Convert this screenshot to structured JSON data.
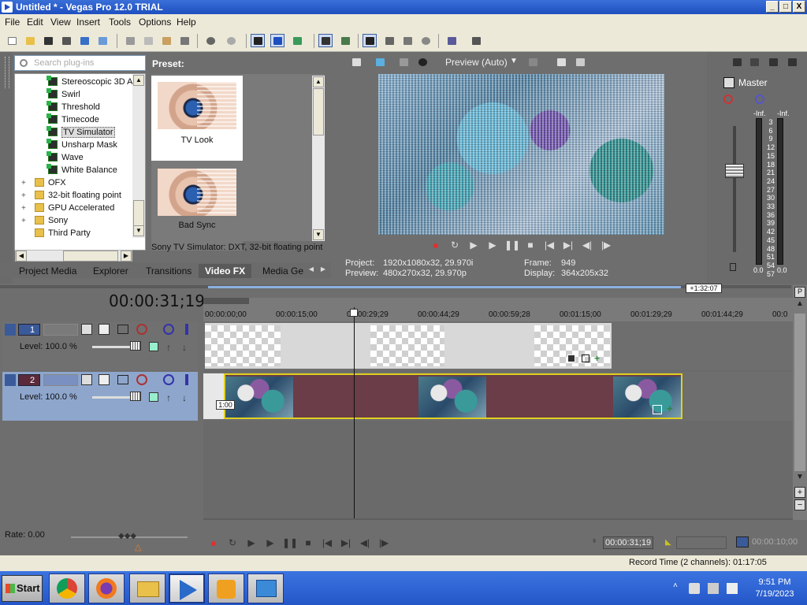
{
  "window": {
    "title": "Untitled * - Vegas Pro 12.0 TRIAL",
    "min": "_",
    "max": "□",
    "close": "X"
  },
  "menu": [
    "File",
    "Edit",
    "View",
    "Insert",
    "Tools",
    "Options",
    "Help"
  ],
  "plugins": {
    "search_placeholder": "Search plug-ins",
    "items": [
      {
        "label": "Stereoscopic 3D A",
        "type": "fx"
      },
      {
        "label": "Swirl",
        "type": "fx"
      },
      {
        "label": "Threshold",
        "type": "fx"
      },
      {
        "label": "Timecode",
        "type": "fx"
      },
      {
        "label": "TV Simulator",
        "type": "fx",
        "selected": true
      },
      {
        "label": "Unsharp Mask",
        "type": "fx"
      },
      {
        "label": "Wave",
        "type": "fx"
      },
      {
        "label": "White Balance",
        "type": "fx"
      },
      {
        "label": "OFX",
        "type": "folder"
      },
      {
        "label": "32-bit floating point",
        "type": "folder"
      },
      {
        "label": "GPU Accelerated",
        "type": "folder"
      },
      {
        "label": "Sony",
        "type": "folder"
      },
      {
        "label": "Third Party",
        "type": "folder"
      }
    ]
  },
  "presets": {
    "label": "Preset:",
    "items": [
      "TV Look",
      "Bad Sync"
    ],
    "description": "Sony TV Simulator: DXT, 32-bit floating point"
  },
  "tabs": [
    "Project Media",
    "Explorer",
    "Transitions",
    "Video FX",
    "Media Ge"
  ],
  "preview": {
    "mode": "Preview (Auto)",
    "project_label": "Project:",
    "project_value": "1920x1080x32, 29.970i",
    "preview_label": "Preview:",
    "preview_value": "480x270x32, 29.970p",
    "frame_label": "Frame:",
    "frame_value": "949",
    "display_label": "Display:",
    "display_value": "364x205x32"
  },
  "mixer": {
    "title": "Master",
    "inf_left": "-Inf.",
    "inf_right": "-Inf.",
    "scale": [
      "3",
      "6",
      "9",
      "12",
      "15",
      "18",
      "21",
      "24",
      "27",
      "30",
      "33",
      "36",
      "39",
      "42",
      "45",
      "48",
      "51",
      "54",
      "57"
    ],
    "level_left": "0.0",
    "level_right": "0.0"
  },
  "timeline": {
    "timecode": "00:00:31;19",
    "end_marker": "+1:32:07",
    "ruler": [
      "00:00:00;00",
      "00:00:15;00",
      "00:00:29;29",
      "00:00:44;29",
      "00:00:59;28",
      "00:01:15;00",
      "00:01:29;29",
      "00:01:44;29",
      "00:0"
    ],
    "tracks": [
      {
        "number": "1",
        "level": "Level: 100.0 %"
      },
      {
        "number": "2",
        "level": "Level: 100.0 %"
      }
    ],
    "fade_label": "1:00"
  },
  "transport": {
    "rate": "Rate: 0.00",
    "cursor_time": "00:00:31;19",
    "selection_length": "00:00:10;00",
    "record_time": "Record Time (2 channels): 01:17:05"
  },
  "taskbar": {
    "start": "Start",
    "time": "9:51 PM",
    "date": "7/19/2023"
  },
  "colors": {
    "title_bar": "#1e4fbf",
    "workspace": "#6e6e6e",
    "selected_track": "#8ea6cc",
    "clip_border": "#e0d020",
    "clip_fill": "#6a3d48"
  }
}
